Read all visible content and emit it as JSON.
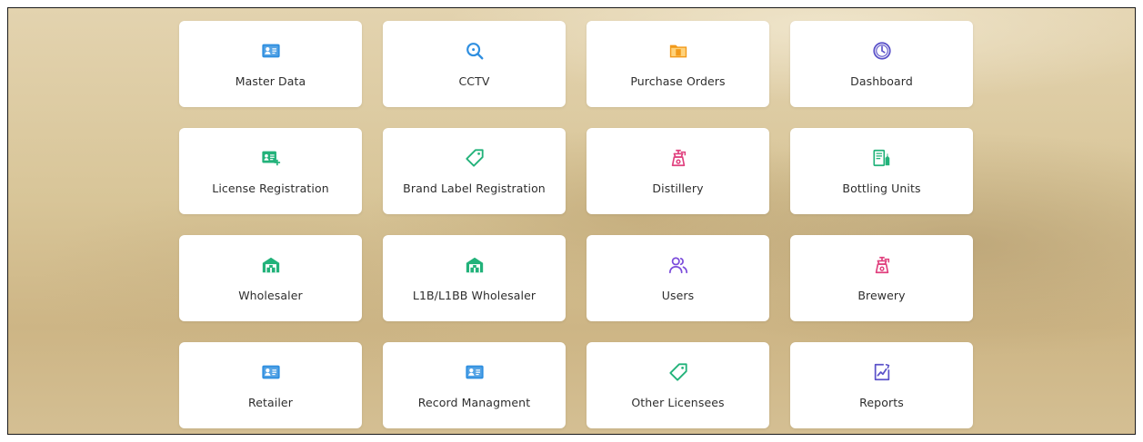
{
  "tiles": [
    {
      "label": "Master Data",
      "icon": "id-card-icon",
      "color": "#2f8fe0"
    },
    {
      "label": "CCTV",
      "icon": "search-icon",
      "color": "#2f8fe0"
    },
    {
      "label": "Purchase Orders",
      "icon": "folder-icon",
      "color": "#f29a1b"
    },
    {
      "label": "Dashboard",
      "icon": "clock-icon",
      "color": "#5b52c9"
    },
    {
      "label": "License Registration",
      "icon": "license-card-icon",
      "color": "#22b27a"
    },
    {
      "label": "Brand Label Registration",
      "icon": "tag-icon",
      "color": "#22b27a"
    },
    {
      "label": "Distillery",
      "icon": "distillery-icon",
      "color": "#e0407e"
    },
    {
      "label": "Bottling Units",
      "icon": "bottling-icon",
      "color": "#22b27a"
    },
    {
      "label": "Wholesaler",
      "icon": "warehouse-icon",
      "color": "#22b27a"
    },
    {
      "label": "L1B/L1BB Wholesaler",
      "icon": "warehouse-icon",
      "color": "#22b27a"
    },
    {
      "label": "Users",
      "icon": "users-icon",
      "color": "#7c4ddb"
    },
    {
      "label": "Brewery",
      "icon": "brewery-icon",
      "color": "#e0407e"
    },
    {
      "label": "Retailer",
      "icon": "id-card-icon",
      "color": "#2f8fe0"
    },
    {
      "label": "Record Managment",
      "icon": "id-card-icon",
      "color": "#2f8fe0"
    },
    {
      "label": "Other Licensees",
      "icon": "tag-icon",
      "color": "#22b27a"
    },
    {
      "label": "Reports",
      "icon": "report-icon",
      "color": "#5b52c9"
    }
  ]
}
